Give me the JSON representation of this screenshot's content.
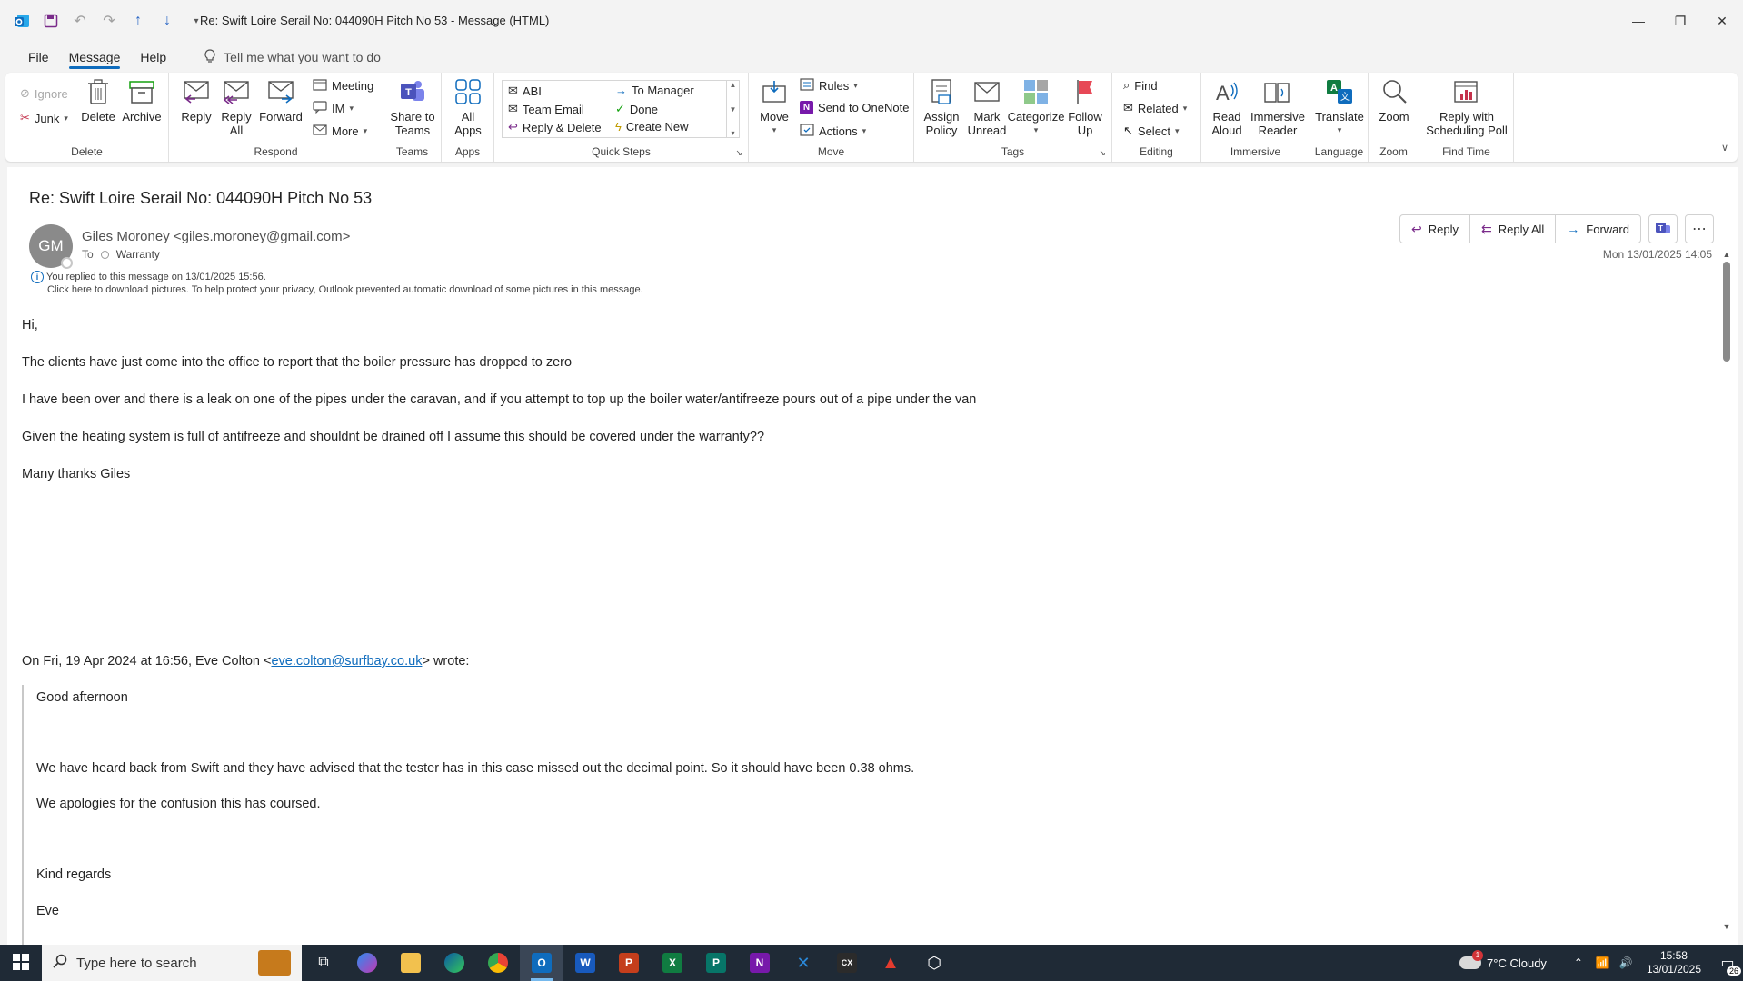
{
  "window": {
    "title": "Re: Swift Loire Serail No: 044090H Pitch No 53  -  Message (HTML)"
  },
  "menu": {
    "tabs": [
      "File",
      "Message",
      "Help"
    ],
    "tell_me": "Tell me what you want to do"
  },
  "ribbon": {
    "delete": {
      "label": "Delete",
      "ignore": "Ignore",
      "junk": "Junk",
      "delete_btn": "Delete",
      "archive": "Archive"
    },
    "respond": {
      "label": "Respond",
      "reply": "Reply",
      "reply_all": "Reply All",
      "forward": "Forward",
      "meeting": "Meeting",
      "im": "IM",
      "more": "More"
    },
    "teams": {
      "label": "Teams",
      "share": "Share to Teams"
    },
    "apps": {
      "label": "Apps",
      "all_apps": "All Apps"
    },
    "quick_steps": {
      "label": "Quick Steps",
      "items": [
        "ABI",
        "To Manager",
        "Team Email",
        "Done",
        "Reply & Delete",
        "Create New"
      ]
    },
    "move": {
      "label": "Move",
      "move_btn": "Move",
      "rules": "Rules",
      "onenote": "Send to OneNote",
      "actions": "Actions"
    },
    "tags": {
      "label": "Tags",
      "assign_policy": "Assign Policy",
      "mark_unread": "Mark Unread",
      "categorize": "Categorize",
      "follow_up": "Follow Up"
    },
    "editing": {
      "label": "Editing",
      "find": "Find",
      "related": "Related",
      "select": "Select"
    },
    "immersive": {
      "label": "Immersive",
      "read_aloud": "Read Aloud",
      "immersive_reader": "Immersive Reader"
    },
    "language": {
      "label": "Language",
      "translate": "Translate"
    },
    "zoom": {
      "label": "Zoom",
      "zoom_btn": "Zoom"
    },
    "find_time": {
      "label": "Find Time",
      "poll": "Reply with Scheduling Poll"
    }
  },
  "message": {
    "subject": "Re: Swift Loire Serail No: 044090H Pitch No 53",
    "avatar_initials": "GM",
    "sender": "Giles Moroney <giles.moroney@gmail.com>",
    "to_label": "To",
    "recipient": "Warranty",
    "replied_info": "You replied to this message on 13/01/2025 15:56.",
    "pictures_info": "Click here to download pictures. To help protect your privacy, Outlook prevented automatic download of some pictures in this message.",
    "date": "Mon 13/01/2025 14:05",
    "actions": {
      "reply": "Reply",
      "reply_all": "Reply All",
      "forward": "Forward"
    },
    "body": [
      "Hi,",
      "The clients have just come into the office to report that the boiler pressure has dropped to zero",
      "I have been over and there is a leak on one of the pipes under the caravan, and if you attempt to top up the boiler water/antifreeze pours out of a pipe under the van",
      "Given the heating system is full of antifreeze and shouldnt be drained off I assume this should be covered under the warranty??",
      "Many thanks Giles"
    ],
    "quoted_header_pre": "On Fri, 19 Apr 2024 at 16:56, Eve Colton <",
    "quoted_header_email": "eve.colton@surfbay.co.uk",
    "quoted_header_post": "> wrote:",
    "quoted": [
      "Good afternoon",
      "We have heard back from Swift and they have advised that the tester has in this case missed out the decimal point. So it should have been 0.38 ohms.",
      "We apologies for the confusion this has coursed.",
      "Kind regards",
      "Eve"
    ]
  },
  "taskbar": {
    "search_placeholder": "Type here to search",
    "weather": "7°C  Cloudy",
    "weather_badge": "1",
    "time": "15:58",
    "date": "13/01/2025",
    "notifications": "26"
  }
}
